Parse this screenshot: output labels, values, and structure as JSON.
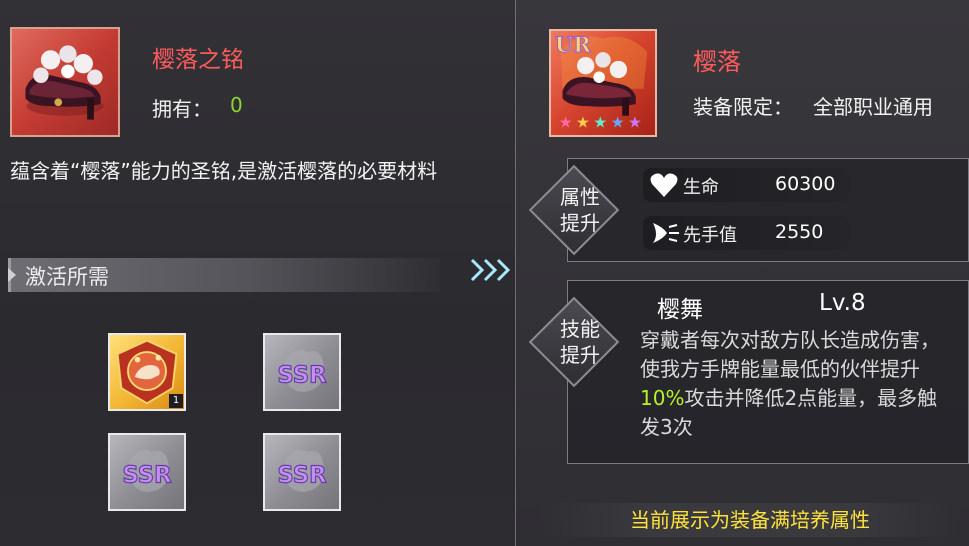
{
  "material": {
    "name": "樱落之铭",
    "own_label": "拥有：",
    "own_count": "0",
    "description": "蕴含着“樱落”能力的圣铭,是激活樱落的必要材料"
  },
  "requirements": {
    "title": "激活所需",
    "items": [
      {
        "kind": "gold-crest-icon",
        "count": "1"
      },
      {
        "kind": "ssr-icon",
        "text": "SSR"
      },
      {
        "kind": "ssr-icon",
        "text": "SSR"
      },
      {
        "kind": "ssr-icon",
        "text": "SSR"
      }
    ]
  },
  "equipment": {
    "rarity": "UR",
    "name": "樱落",
    "limit_label": "装备限定：",
    "limit_value": "全部职业通用",
    "stars": 5
  },
  "attributes": {
    "section_label_1": "属性",
    "section_label_2": "提升",
    "stats": [
      {
        "icon": "heart-icon",
        "label": "生命",
        "value": "60300"
      },
      {
        "icon": "speed-icon",
        "label": "先手值",
        "value": "2550"
      }
    ]
  },
  "skill": {
    "section_label_1": "技能",
    "section_label_2": "提升",
    "name": "樱舞",
    "level": "Lv.8",
    "desc_part1": "穿戴者每次对敌方队长造成伤害，使我方手牌能量最低的伙伴提升",
    "desc_highlight": "10%",
    "desc_part2": "攻击并降低2点能量，最多触发3次"
  },
  "footer_text": "当前展示为装备满培养属性",
  "colors": {
    "name_red": "#ff5b5b",
    "count_green": "#8ad62e",
    "highlight_green": "#b6f22c",
    "footer_yellow": "#ffe23a"
  }
}
